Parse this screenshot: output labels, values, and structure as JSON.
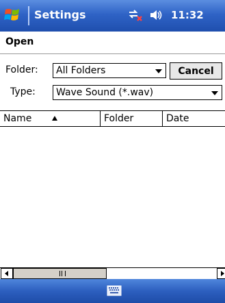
{
  "titlebar": {
    "app_name": "Settings",
    "clock": "11:32"
  },
  "heading": {
    "label": "Open"
  },
  "form": {
    "folder_label": "Folder:",
    "folder_value": "All Folders",
    "cancel_label": "Cancel",
    "type_label": "Type:",
    "type_value": "Wave Sound (*.wav)"
  },
  "list": {
    "columns": [
      {
        "label": "Name",
        "sort": "ascending"
      },
      {
        "label": "Folder"
      },
      {
        "label": "Date"
      }
    ],
    "rows": []
  },
  "colors": {
    "titlebar": "#2f63c6",
    "bottombar": "#2d5fbf",
    "background": "#ffffff"
  },
  "icons": [
    "windows-start-icon",
    "connectivity-icon",
    "speaker-icon",
    "keyboard-icon"
  ]
}
